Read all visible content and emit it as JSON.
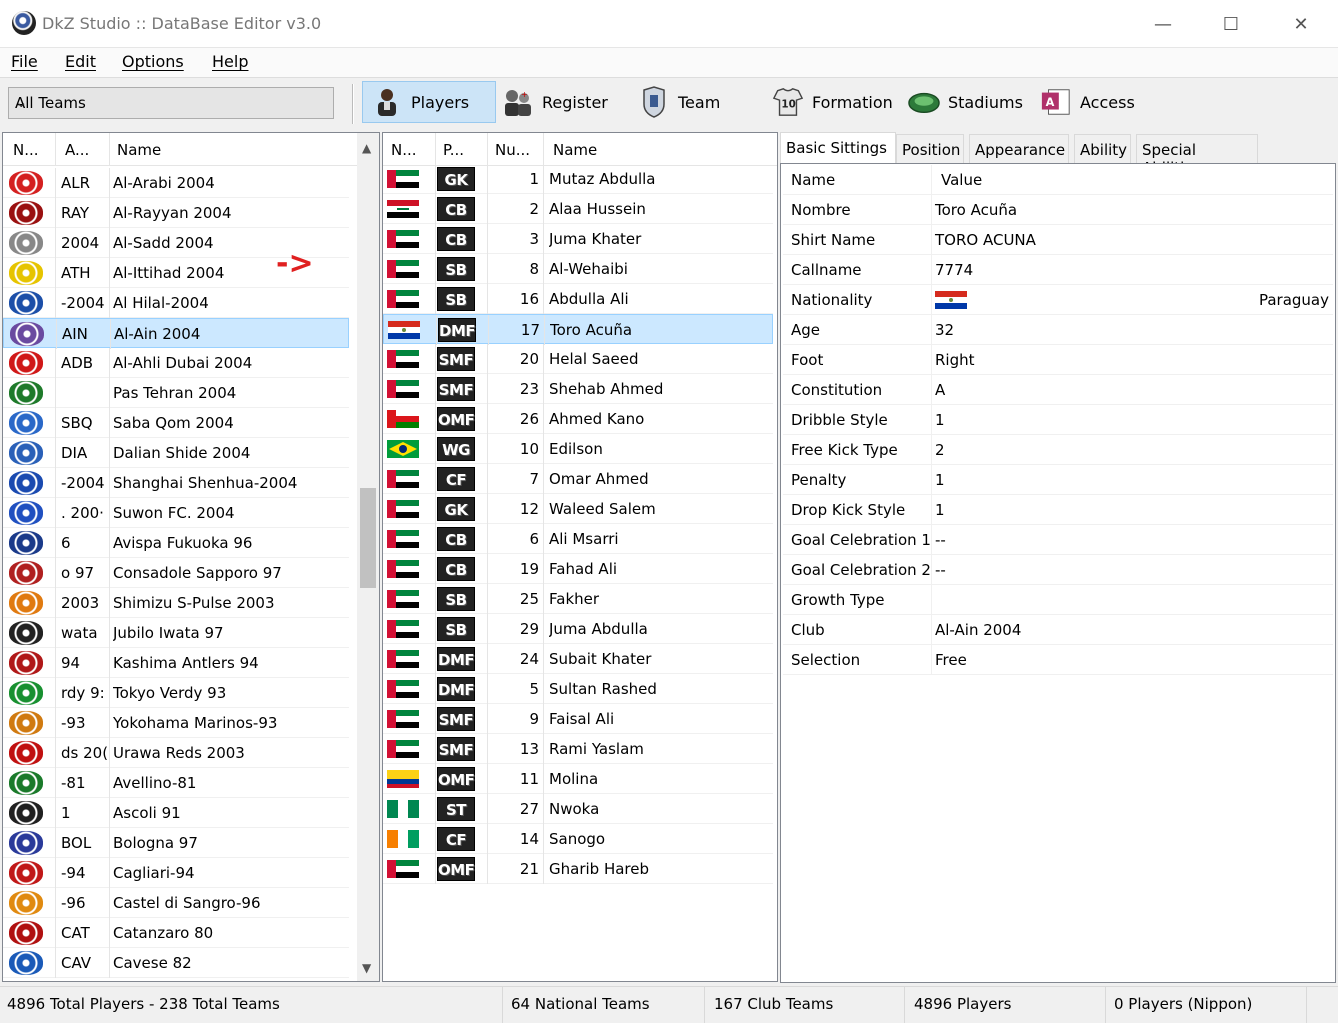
{
  "window": {
    "title": "DkZ Studio :: DataBase Editor v3.0",
    "minimize": "—",
    "maximize": "☐",
    "close": "✕"
  },
  "menu": [
    "File",
    "Edit",
    "Options",
    "Help"
  ],
  "toolbar": {
    "team_filter": "All Teams",
    "buttons": [
      {
        "label": "Players",
        "icon": "player-icon",
        "active": true
      },
      {
        "label": "Register",
        "icon": "register-icon"
      },
      {
        "label": "Team",
        "icon": "team-icon"
      },
      {
        "label": "Formation",
        "icon": "formation-icon"
      },
      {
        "label": "Stadiums",
        "icon": "stadium-icon"
      },
      {
        "label": "Access",
        "icon": "access-icon"
      }
    ]
  },
  "teams": {
    "headers": [
      "N...",
      "A...",
      "Name"
    ],
    "rows": [
      {
        "abbr": "ALR",
        "name": "Al-Arabi 2004",
        "color": "#d42020"
      },
      {
        "abbr": "RAY",
        "name": "Al-Rayyan 2004",
        "color": "#9a1010"
      },
      {
        "abbr": "2004",
        "name": "Al-Sadd 2004",
        "color": "#888888"
      },
      {
        "abbr": "ATH",
        "name": "Al-Ittihad 2004",
        "color": "#e6c400"
      },
      {
        "abbr": "-2004",
        "name": "Al Hilal-2004",
        "color": "#1c4fa8"
      },
      {
        "abbr": "AIN",
        "name": "Al-Ain 2004",
        "color": "#6a4aa0",
        "selected": true
      },
      {
        "abbr": "ADB",
        "name": "Al-Ahli Dubai 2004",
        "color": "#d01818"
      },
      {
        "abbr": "",
        "name": "Pas Tehran 2004",
        "color": "#1e7a2a"
      },
      {
        "abbr": "SBQ",
        "name": "Saba Qom 2004",
        "color": "#2a68c8"
      },
      {
        "abbr": "DIA",
        "name": "Dalian Shide 2004",
        "color": "#2a60b8"
      },
      {
        "abbr": "-2004",
        "name": "Shanghai Shenhua-2004",
        "color": "#1a4ab0"
      },
      {
        "abbr": ". 200·",
        "name": "Suwon FC. 2004",
        "color": "#2050c0"
      },
      {
        "abbr": "6",
        "name": "Avispa Fukuoka 96",
        "color": "#1a3a8a"
      },
      {
        "abbr": "o 97",
        "name": "Consadole Sapporo 97",
        "color": "#b02020"
      },
      {
        "abbr": "2003",
        "name": "Shimizu S-Pulse 2003",
        "color": "#e07a10"
      },
      {
        "abbr": "wata",
        "name": "Jubilo Iwata 97",
        "color": "#222222"
      },
      {
        "abbr": "94",
        "name": "Kashima Antlers 94",
        "color": "#b01818"
      },
      {
        "abbr": "rdy 9:",
        "name": "Tokyo Verdy 93",
        "color": "#189030"
      },
      {
        "abbr": "-93",
        "name": "Yokohama Marinos-93",
        "color": "#d07a10"
      },
      {
        "abbr": "ds 20(",
        "name": "Urawa Reds 2003",
        "color": "#c01010"
      },
      {
        "abbr": "-81",
        "name": "Avellino-81",
        "color": "#1a7a2a"
      },
      {
        "abbr": "1",
        "name": "Ascoli 91",
        "color": "#202020"
      },
      {
        "abbr": "BOL",
        "name": "Bologna 97",
        "color": "#2a3a9a"
      },
      {
        "abbr": "-94",
        "name": "Cagliari-94",
        "color": "#c01818"
      },
      {
        "abbr": "-96",
        "name": "Castel di Sangro-96",
        "color": "#e08a10"
      },
      {
        "abbr": "CAT",
        "name": "Catanzaro 80",
        "color": "#b01010"
      },
      {
        "abbr": "CAV",
        "name": "Cavese 82",
        "color": "#1a5ab8"
      }
    ]
  },
  "annotation_arrow": "->",
  "players": {
    "headers": [
      "N...",
      "P...",
      "Nu...",
      "Name"
    ],
    "rows": [
      {
        "flag": "uae",
        "pos": "GK",
        "num": "1",
        "name": "Mutaz Abdulla"
      },
      {
        "flag": "iraq",
        "pos": "CB",
        "num": "2",
        "name": "Alaa Hussein"
      },
      {
        "flag": "uae",
        "pos": "CB",
        "num": "3",
        "name": "Juma Khater"
      },
      {
        "flag": "uae",
        "pos": "SB",
        "num": "8",
        "name": "Al-Wehaibi"
      },
      {
        "flag": "uae",
        "pos": "SB",
        "num": "16",
        "name": "Abdulla Ali"
      },
      {
        "flag": "paraguay",
        "pos": "DMF",
        "num": "17",
        "name": "Toro Acuña",
        "selected": true
      },
      {
        "flag": "uae",
        "pos": "SMF",
        "num": "20",
        "name": "Helal Saeed"
      },
      {
        "flag": "uae",
        "pos": "SMF",
        "num": "23",
        "name": "Shehab Ahmed"
      },
      {
        "flag": "oman",
        "pos": "OMF",
        "num": "26",
        "name": "Ahmed Kano"
      },
      {
        "flag": "brazil",
        "pos": "WG",
        "num": "10",
        "name": "Edilson"
      },
      {
        "flag": "uae",
        "pos": "CF",
        "num": "7",
        "name": "Omar Ahmed"
      },
      {
        "flag": "uae",
        "pos": "GK",
        "num": "12",
        "name": "Waleed Salem"
      },
      {
        "flag": "uae",
        "pos": "CB",
        "num": "6",
        "name": "Ali Msarri"
      },
      {
        "flag": "uae",
        "pos": "CB",
        "num": "19",
        "name": "Fahad Ali"
      },
      {
        "flag": "uae",
        "pos": "SB",
        "num": "25",
        "name": "Fakher"
      },
      {
        "flag": "uae",
        "pos": "SB",
        "num": "29",
        "name": "Juma Abdulla"
      },
      {
        "flag": "uae",
        "pos": "DMF",
        "num": "24",
        "name": "Subait Khater"
      },
      {
        "flag": "uae",
        "pos": "DMF",
        "num": "5",
        "name": "Sultan Rashed"
      },
      {
        "flag": "uae",
        "pos": "SMF",
        "num": "9",
        "name": "Faisal Ali"
      },
      {
        "flag": "uae",
        "pos": "SMF",
        "num": "13",
        "name": "Rami Yaslam"
      },
      {
        "flag": "colombia",
        "pos": "OMF",
        "num": "11",
        "name": "Molina"
      },
      {
        "flag": "nigeria",
        "pos": "ST",
        "num": "27",
        "name": "Nwoka"
      },
      {
        "flag": "ivorycoast",
        "pos": "CF",
        "num": "14",
        "name": "Sanogo"
      },
      {
        "flag": "uae",
        "pos": "OMF",
        "num": "21",
        "name": "Gharib Hareb"
      }
    ]
  },
  "tabs": [
    "Basic Sittings",
    "Position",
    "Appearance",
    "Ability",
    "Special Abilities"
  ],
  "properties": {
    "headers": [
      "Name",
      "Value"
    ],
    "rows": [
      {
        "key": "Nombre",
        "value": "Toro Acuña"
      },
      {
        "key": "Shirt Name",
        "value": "TORO ACUNA"
      },
      {
        "key": "Callname",
        "value": "7774"
      },
      {
        "key": "Nationality",
        "value": "Paraguay",
        "flag": "paraguay"
      },
      {
        "key": "Age",
        "value": "32"
      },
      {
        "key": "Foot",
        "value": "Right"
      },
      {
        "key": "Constitution",
        "value": "A"
      },
      {
        "key": "Dribble Style",
        "value": "1"
      },
      {
        "key": "Free Kick Type",
        "value": "2"
      },
      {
        "key": "Penalty",
        "value": "1"
      },
      {
        "key": "Drop Kick Style",
        "value": "1"
      },
      {
        "key": "Goal Celebration 1",
        "value": "--"
      },
      {
        "key": "Goal Celebration 2",
        "value": "--"
      },
      {
        "key": "Growth Type",
        "value": ""
      },
      {
        "key": "Club",
        "value": "Al-Ain 2004"
      },
      {
        "key": "Selection",
        "value": "Free"
      }
    ]
  },
  "status": [
    "4896 Total Players  -  238 Total Teams",
    "64 National Teams",
    "167 Club Teams",
    "4896 Players",
    "0 Players (Nippon)"
  ]
}
